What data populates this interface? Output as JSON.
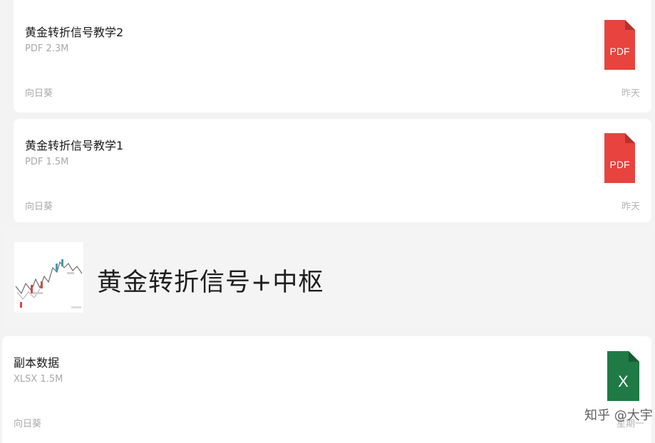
{
  "files": [
    {
      "title": "黄金转折信号教学2",
      "meta": "PDF 2.3M",
      "sender": "向日葵",
      "time": "昨天",
      "icon": "pdf-icon",
      "icon_label": "PDF",
      "icon_color": "#e8433e"
    },
    {
      "title": "黄金转折信号教学1",
      "meta": "PDF 1.5M",
      "sender": "向日葵",
      "time": "昨天",
      "icon": "pdf-icon",
      "icon_label": "PDF",
      "icon_color": "#e8433e"
    },
    {
      "title": "副本数据",
      "meta": "XLSX 1.5M",
      "sender": "向日葵",
      "time": "星期一",
      "icon": "excel-icon",
      "icon_label": "X",
      "icon_color": "#1f7a45"
    }
  ],
  "link_card": {
    "title": "黄金转折信号+中枢",
    "thumbnail": "chart-thumbnail-icon"
  },
  "watermark": {
    "text": "知乎 @大宇"
  }
}
